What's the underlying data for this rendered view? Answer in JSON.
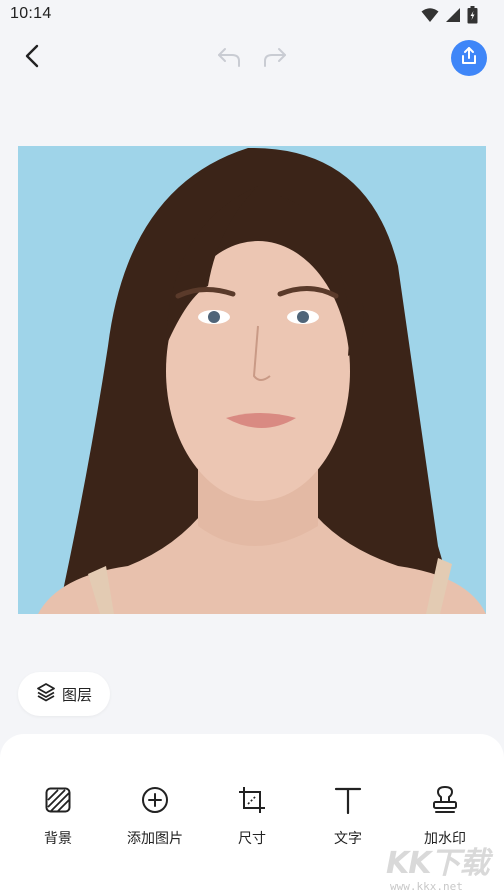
{
  "status_bar": {
    "time": "10:14",
    "icons": [
      "wifi-icon",
      "cellular-signal-icon",
      "battery-charging-icon"
    ]
  },
  "app_bar": {
    "icons": [
      "back-arrow-icon",
      "undo-icon",
      "redo-icon",
      "share-icon"
    ],
    "share_color": "#3f86f8",
    "undo_enabled": false,
    "redo_enabled": false
  },
  "canvas": {
    "background_color": "#9ed3e8",
    "subject": "portrait photo"
  },
  "layers_chip": {
    "label": "图层",
    "icon": "layers-icon"
  },
  "tools": [
    {
      "label": "背景",
      "icon": "background-pattern-icon"
    },
    {
      "label": "添加图片",
      "icon": "add-circle-icon"
    },
    {
      "label": "尺寸",
      "icon": "crop-size-icon"
    },
    {
      "label": "文字",
      "icon": "text-icon"
    },
    {
      "label": "加水印",
      "icon": "stamp-icon"
    }
  ],
  "watermark": {
    "logo": "KK下载",
    "url": "www.kkx.net"
  }
}
